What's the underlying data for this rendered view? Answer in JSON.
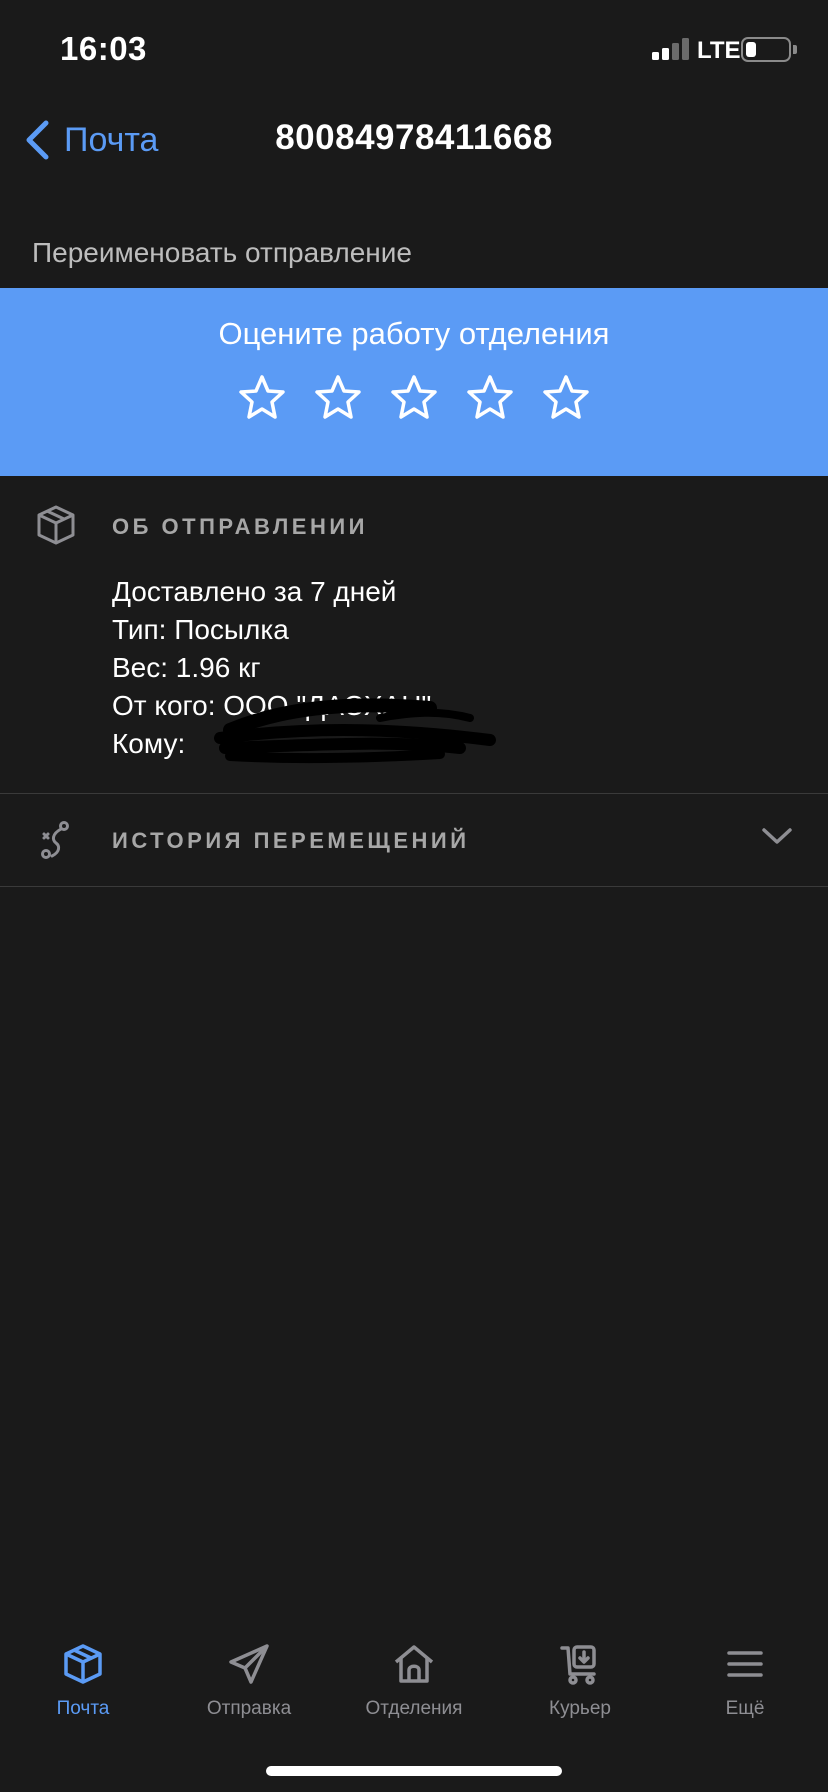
{
  "status_bar": {
    "time": "16:03",
    "network": "LTE",
    "signal_icon": "signal-bars-icon",
    "battery_icon": "battery-icon",
    "battery_level": 0.25
  },
  "nav": {
    "back_label": "Почта",
    "title": "80084978411668"
  },
  "rename_label": "Переименовать отправление",
  "rating": {
    "title": "Оцените работу отделения",
    "star_count": 5,
    "rating_value": 0,
    "banner_color": "#5b9bf5"
  },
  "about": {
    "header": "ОБ ОТПРАВЛЕНИИ",
    "icon": "package-icon",
    "lines": [
      "Доставлено за 7 дней",
      "Тип: Посылка",
      "Вес: 1.96 кг",
      "От кого: ООО \"ДАОХАН\"",
      "Кому:"
    ]
  },
  "history": {
    "header": "ИСТОРИЯ ПЕРЕМЕЩЕНИЙ",
    "icon": "route-icon"
  },
  "tabs": [
    {
      "label": "Почта",
      "icon": "package-icon",
      "active": true
    },
    {
      "label": "Отправка",
      "icon": "send-icon",
      "active": false
    },
    {
      "label": "Отделения",
      "icon": "house-icon",
      "active": false
    },
    {
      "label": "Курьер",
      "icon": "courier-cart-icon",
      "active": false
    },
    {
      "label": "Ещё",
      "icon": "menu-icon",
      "active": false
    }
  ],
  "colors": {
    "accent": "#5b9bf5",
    "background": "#1a1a1a",
    "muted": "#8e8e93",
    "divider": "#3a3a3a"
  }
}
